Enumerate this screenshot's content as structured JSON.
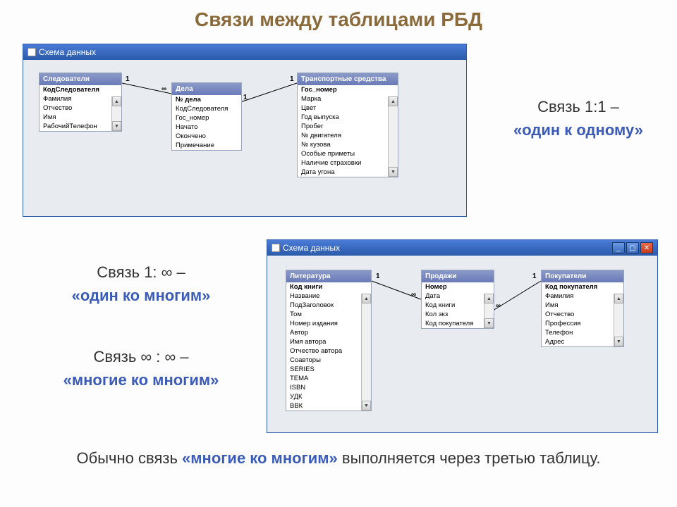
{
  "slide_title": "Связи между таблицами РБД",
  "window1": {
    "title": "Схема данных",
    "entities": {
      "investigators": {
        "header": "Следователи",
        "fields": [
          "КодСледователя",
          "Фамилия",
          "Отчество",
          "Имя",
          "РабочийТелефон"
        ]
      },
      "cases": {
        "header": "Дела",
        "fields": [
          "№ дела",
          "КодСледователя",
          "Гос_номер",
          "Начато",
          "Окончено",
          "Примечание"
        ]
      },
      "vehicles": {
        "header": "Транспортные средства",
        "fields": [
          "Гос_номер",
          "Марка",
          "Цвет",
          "Год выпуска",
          "Пробег",
          "№ двигателя",
          "№ кузова",
          "Особые приметы",
          "Наличие страховки",
          "Дата угона"
        ]
      }
    }
  },
  "window2": {
    "title": "Схема данных",
    "entities": {
      "literature": {
        "header": "Литература",
        "fields": [
          "Код книги",
          "Название",
          "ПодЗаголовок",
          "Том",
          "Номер издания",
          "Автор",
          "Имя автора",
          "Отчество автора",
          "Соавторы",
          "SERIES",
          "ТЕМА",
          "ISBN",
          "УДК",
          "ВВК"
        ]
      },
      "sales": {
        "header": "Продажи",
        "fields": [
          "Номер",
          "Дата",
          "Код книги",
          "Кол экз",
          "Код покупателя"
        ]
      },
      "buyers": {
        "header": "Покупатели",
        "fields": [
          "Код покупателя",
          "Фамилия",
          "Имя",
          "Отчество",
          "Профессия",
          "Телефон",
          "Адрес"
        ]
      }
    }
  },
  "text1_a": "Связь 1:1 –",
  "text1_b": "«один к одному»",
  "text2_a": "Связь 1: ∞ –",
  "text2_b": "«один ко многим»",
  "text3_a": "Связь ∞ : ∞ –",
  "text3_b": "«многие ко многим»",
  "footer_a": "Обычно связь ",
  "footer_b": "«многие ко многим»",
  "footer_c": " выполняется через третью таблицу.",
  "one": "1",
  "inf": "∞",
  "btn_min": "_",
  "btn_max": "▢",
  "btn_close": "✕",
  "arrow_up": "▲",
  "arrow_down": "▼"
}
